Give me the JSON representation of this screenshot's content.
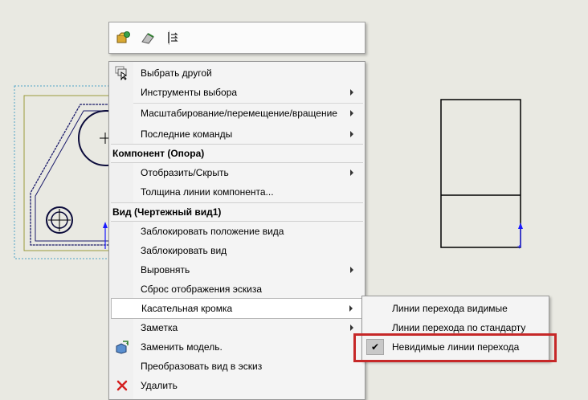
{
  "mini_toolbar": {
    "icons": [
      "open-part-icon",
      "hide-show-icon",
      "rebuild-icon"
    ]
  },
  "context_menu": {
    "items": [
      {
        "label": "Выбрать другой",
        "icon": "select-other-icon",
        "submenu": false
      },
      {
        "label": "Инструменты выбора",
        "submenu": true
      },
      {
        "label": "Масштабирование/перемещение/вращение",
        "submenu": true
      },
      {
        "label": "Последние команды",
        "submenu": true
      }
    ],
    "component_header": "Компонент (Опора)",
    "component_items": [
      {
        "label": "Отобразить/Скрыть",
        "submenu": true
      },
      {
        "label": "Толщина линии компонента...",
        "submenu": false
      }
    ],
    "view_header": "Вид (Чертежный вид1)",
    "view_items": [
      {
        "label": "Заблокировать положение вида",
        "submenu": false
      },
      {
        "label": "Заблокировать вид",
        "submenu": false
      },
      {
        "label": "Выровнять",
        "submenu": true
      },
      {
        "label": "Сброс отображения эскиза",
        "submenu": false
      },
      {
        "label": "Касательная кромка",
        "submenu": true,
        "highlighted": true
      },
      {
        "label": "Заметка",
        "submenu": true
      },
      {
        "label": "Заменить модель.",
        "icon": "replace-model-icon",
        "submenu": false
      },
      {
        "label": "Преобразовать вид в эскиз",
        "submenu": false
      },
      {
        "label": "Удалить",
        "icon": "delete-icon",
        "submenu": false
      }
    ]
  },
  "submenu": {
    "items": [
      {
        "label": "Линии перехода видимые",
        "checked": false
      },
      {
        "label": "Линии перехода по стандарту",
        "checked": false
      },
      {
        "label": "Невидимые линии перехода",
        "checked": true
      }
    ],
    "check_glyph": "✔"
  },
  "colors": {
    "canvas": "#e9e9e2",
    "annotation": "#c62828",
    "axis_blue": "#1a1aff"
  }
}
